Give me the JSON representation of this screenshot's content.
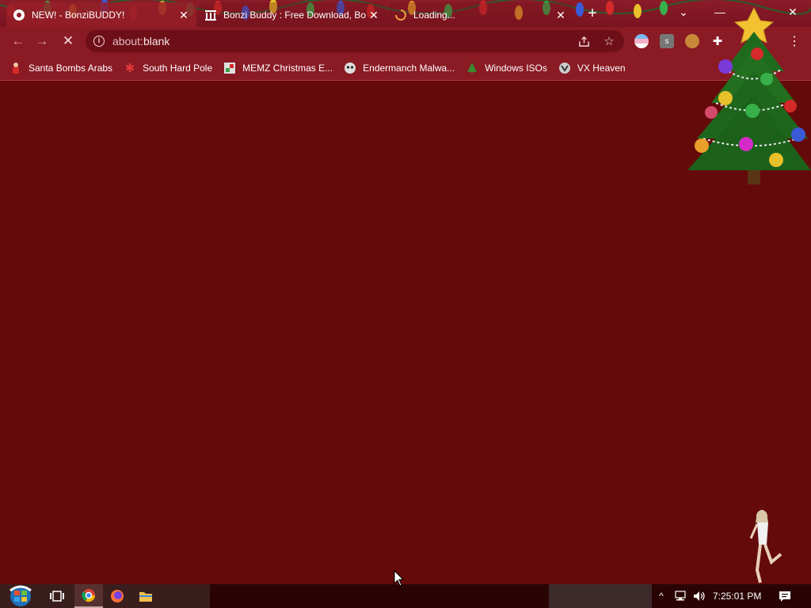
{
  "tabs": [
    {
      "title": "NEW! - BonziBUDDY!",
      "favicon": "chrome-globe-icon",
      "active": true
    },
    {
      "title": "Bonzi Buddy : Free Download, Bo",
      "favicon": "archive-icon",
      "active": false
    },
    {
      "title": "Loading...",
      "favicon": "loading-spinner-icon",
      "active": false
    }
  ],
  "address": {
    "scheme": "about:",
    "path": "blank"
  },
  "bookmarks": [
    {
      "label": "Santa Bombs Arabs",
      "icon": "santa-icon"
    },
    {
      "label": "South Hard Pole",
      "icon": "snowflake-icon"
    },
    {
      "label": "MEMZ Christmas E...",
      "icon": "memz-icon"
    },
    {
      "label": "Endermanch Malwa...",
      "icon": "endermanch-icon"
    },
    {
      "label": "Windows ISOs",
      "icon": "tree-icon"
    },
    {
      "label": "VX Heaven",
      "icon": "vx-heaven-icon"
    }
  ],
  "taskbar": {
    "clock": "7:25:01 PM"
  },
  "colors": {
    "page_bg": "#650a0a",
    "toolbar_bg": "#8a1a24",
    "tabstrip_bg": "#8a1c28",
    "taskbar_bg": "#2a0404"
  }
}
